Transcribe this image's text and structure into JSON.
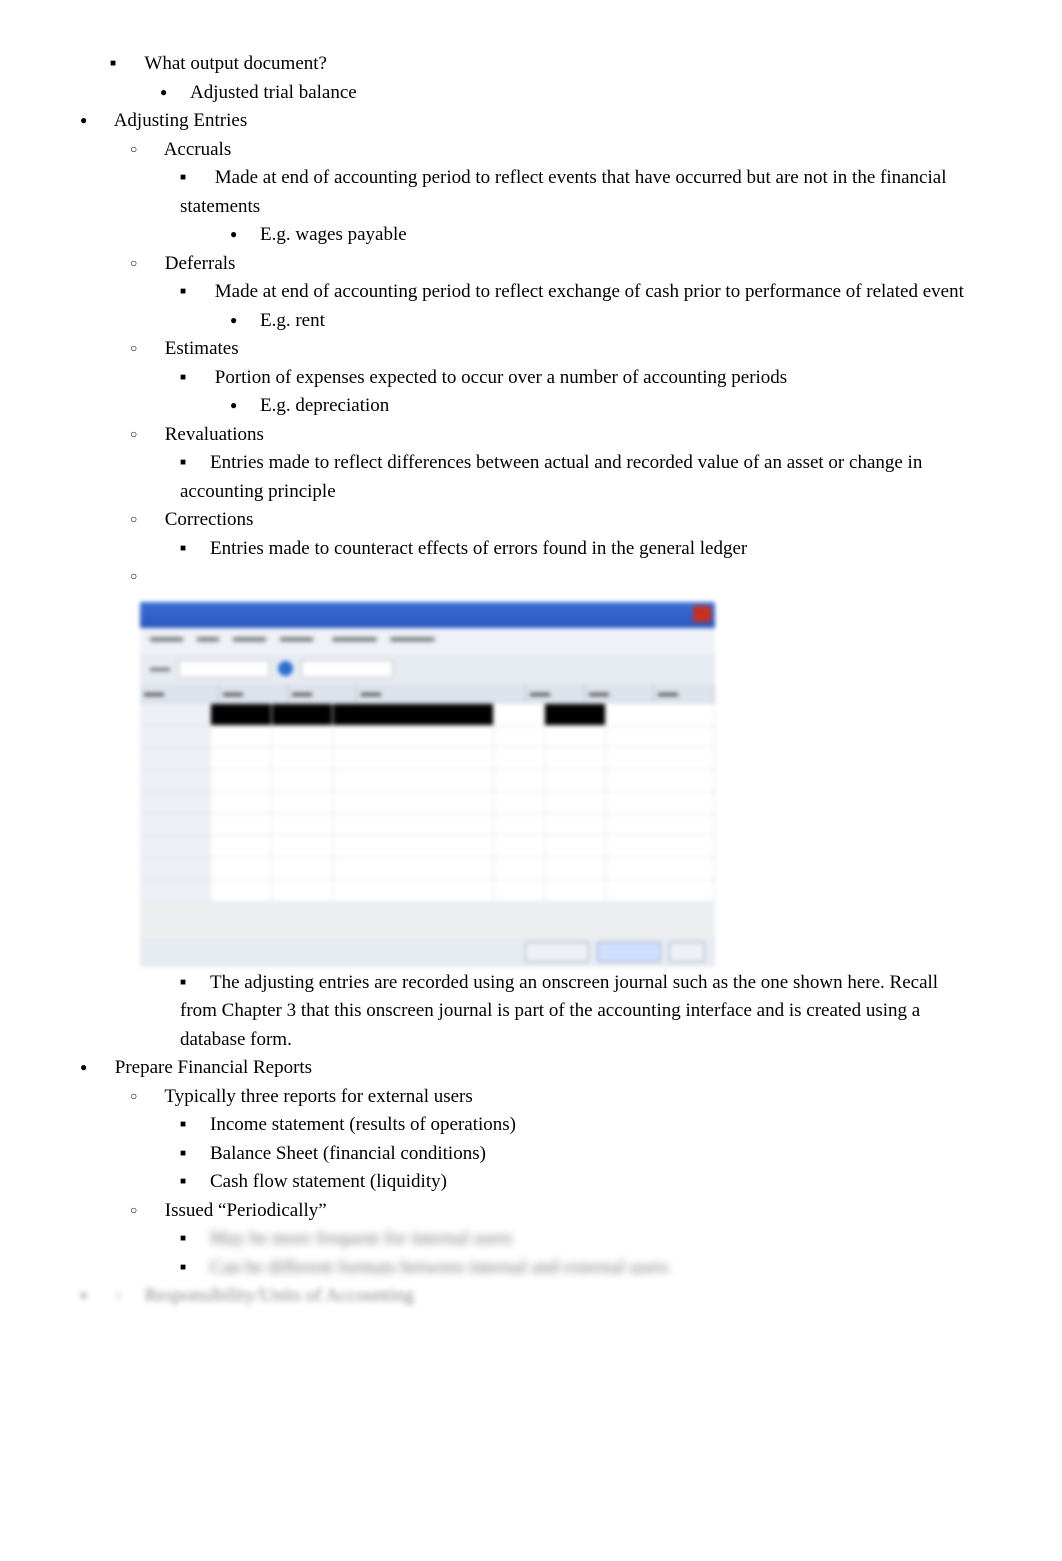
{
  "outline": {
    "top_square": "What output document?",
    "top_bullet": "Adjusted trial balance",
    "adjusting_entries": {
      "title": "Adjusting Entries",
      "accruals": {
        "title": "Accruals",
        "desc": "Made at end of accounting period to reflect events that have occurred but are not in the financial statements",
        "example": "E.g. wages payable"
      },
      "deferrals": {
        "title": "Deferrals",
        "desc": "Made at end of accounting period to reflect exchange of cash prior to performance of related event",
        "example": "E.g. rent"
      },
      "estimates": {
        "title": "Estimates",
        "desc": "Portion of expenses expected to occur over a number of accounting periods",
        "example": "E.g. depreciation"
      },
      "revaluations": {
        "title": "Revaluations",
        "desc": "Entries made to reflect differences between actual and recorded value of an asset or change in accounting principle"
      },
      "corrections": {
        "title": "Corrections",
        "desc": "Entries made to counteract effects of errors found in the general ledger"
      },
      "caption": "The adjusting entries are recorded using an onscreen journal such as the one shown here. Recall from Chapter 3 that this onscreen journal is part of the accounting interface and is created using a database form."
    },
    "prepare_reports": {
      "title": "Prepare Financial Reports",
      "three_reports": {
        "title": "Typically three reports for external users",
        "r1": "Income statement (results of operations)",
        "r2": "Balance Sheet (financial conditions)",
        "r3": "Cash flow statement (liquidity)"
      },
      "periodically": {
        "title": "Issued “Periodically”",
        "hidden1": "May be more frequent for internal users",
        "hidden2": "Can be different formats between internal and external users"
      }
    },
    "hidden_last": "Responsibility/Units of Accounting"
  }
}
